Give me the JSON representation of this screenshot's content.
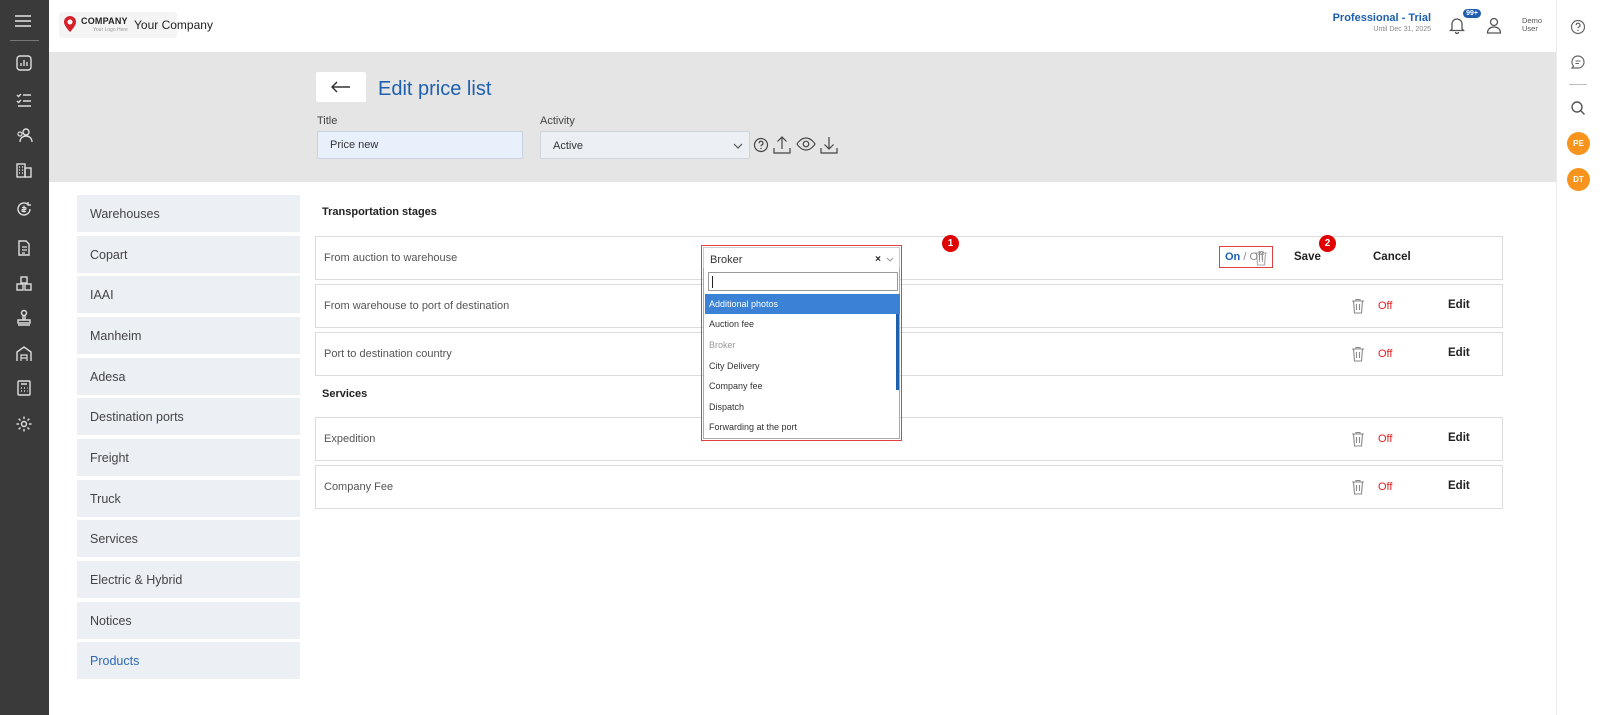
{
  "header": {
    "logo_text": "COMPANY",
    "logo_sub": "Your Logo Here",
    "company_name": "Your Company",
    "plan": "Professional - Trial",
    "plan_until": "Until Dec 31, 2025",
    "notif_badge": "99+",
    "user_line1": "Demo",
    "user_line2": "User"
  },
  "page": {
    "title": "Edit price list",
    "title_label": "Title",
    "title_value": "Price new",
    "activity_label": "Activity",
    "activity_value": "Active"
  },
  "sidebar": {
    "items": [
      {
        "label": "Warehouses"
      },
      {
        "label": "Copart"
      },
      {
        "label": "IAAI"
      },
      {
        "label": "Manheim"
      },
      {
        "label": "Adesa"
      },
      {
        "label": "Destination ports"
      },
      {
        "label": "Freight"
      },
      {
        "label": "Truck"
      },
      {
        "label": "Services"
      },
      {
        "label": "Electric & Hybrid"
      },
      {
        "label": "Notices"
      },
      {
        "label": "Products"
      }
    ],
    "active": "Products"
  },
  "sections": {
    "transport": "Transportation stages",
    "services": "Services"
  },
  "rows": [
    {
      "name": "From auction to warehouse"
    },
    {
      "name": "From warehouse to port of destination",
      "status": "Off",
      "action": "Edit"
    },
    {
      "name": "Port to destination country",
      "status": "Off",
      "action": "Edit"
    },
    {
      "name": "Expedition",
      "status": "Off",
      "action": "Edit"
    },
    {
      "name": "Company Fee",
      "status": "Off",
      "action": "Edit"
    }
  ],
  "editing": {
    "selected": "Broker",
    "clear": "×",
    "options": [
      {
        "label": "Additional photos",
        "state": "highlighted"
      },
      {
        "label": "Auction fee",
        "state": "normal"
      },
      {
        "label": "Broker",
        "state": "disabled"
      },
      {
        "label": "City Delivery",
        "state": "normal"
      },
      {
        "label": "Company fee",
        "state": "normal"
      },
      {
        "label": "Dispatch",
        "state": "normal"
      },
      {
        "label": "Forwarding at the port",
        "state": "normal"
      }
    ],
    "on": "On",
    "slash": "/",
    "off": "Off",
    "save": "Save",
    "cancel": "Cancel"
  },
  "markers": [
    "1",
    "2"
  ],
  "rightrail": {
    "avatar1": "PE",
    "avatar2": "DT"
  },
  "colors": {
    "accent": "#1e5fb0",
    "off_red": "#e02020",
    "marker_red": "#e00000",
    "avatar": "#f7941d",
    "rail": "#3a3a3a"
  },
  "icons": {
    "rail": [
      "menu-icon",
      "dashboard-icon",
      "checklist-icon",
      "users-icon",
      "building-icon",
      "money-cycle-icon",
      "document-icon",
      "boxes-icon",
      "stamp-icon",
      "warehouse-icon",
      "calculator-icon",
      "settings-icon"
    ],
    "header": [
      "help-icon",
      "upload-icon",
      "eye-icon",
      "download-icon"
    ]
  }
}
